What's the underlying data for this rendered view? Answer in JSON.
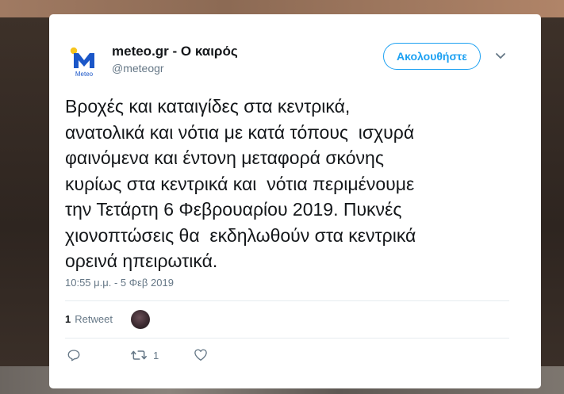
{
  "account": {
    "display_name": "meteo.gr - Ο καιρός",
    "handle": "@meteogr",
    "avatar_text": "Meteo"
  },
  "follow_label": "Ακολουθήστε",
  "tweet": {
    "text": "Βροχές και καταιγίδες στα κεντρικά,\nανατολικά και νότια με κατά τόπους  ισχυρά\nφαινόμενα και έντονη μεταφορά σκόνης\nκυρίως στα κεντρικά και  νότια περιμένουμε\nτην Τετάρτη 6 Φεβρουαρίου 2019. Πυκνές\nχιονοπτώσεις θα  εκδηλωθούν στα κεντρικά\nορεινά ηπειρωτικά.",
    "timestamp": "10:55 μ.μ. - 5 Φεβ 2019"
  },
  "stats": {
    "retweet_count": "1",
    "retweet_label": "Retweet"
  },
  "actions": {
    "reply_icon": "reply-icon",
    "retweet_icon": "retweet-icon",
    "retweet_count": "1",
    "like_icon": "heart-icon"
  },
  "colors": {
    "accent": "#1da1f2",
    "secondary_text": "#657786",
    "primary_text": "#14171a",
    "logo_blue": "#1a56c8",
    "logo_yellow": "#f7c51e"
  }
}
